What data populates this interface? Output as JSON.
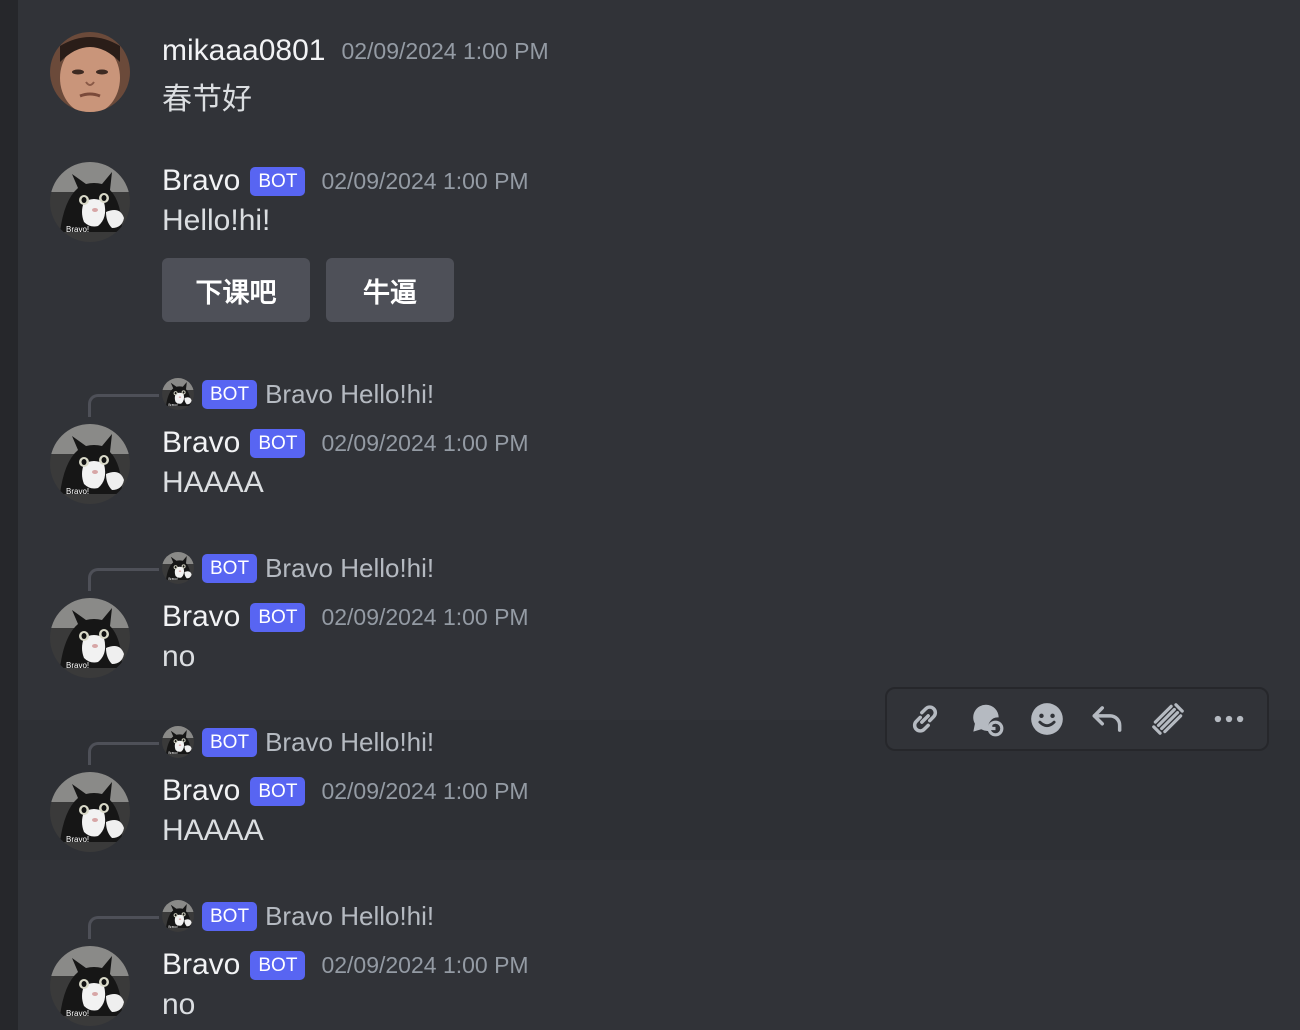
{
  "messages": [
    {
      "username": "mikaaa0801",
      "timestamp": "02/09/2024 1:00 PM",
      "content": "春节好"
    },
    {
      "username": "Bravo",
      "bot_tag": "BOT",
      "timestamp": "02/09/2024 1:00 PM",
      "content": "Hello!hi!",
      "buttons": [
        "下课吧",
        "牛逼"
      ]
    },
    {
      "reply": {
        "tag": "BOT",
        "text": "Bravo Hello!hi!"
      },
      "username": "Bravo",
      "bot_tag": "BOT",
      "timestamp": "02/09/2024 1:00 PM",
      "content": "HAAAA"
    },
    {
      "reply": {
        "tag": "BOT",
        "text": "Bravo Hello!hi!"
      },
      "username": "Bravo",
      "bot_tag": "BOT",
      "timestamp": "02/09/2024 1:00 PM",
      "content": "no"
    },
    {
      "reply": {
        "tag": "BOT",
        "text": "Bravo Hello!hi!"
      },
      "username": "Bravo",
      "bot_tag": "BOT",
      "timestamp": "02/09/2024 1:00 PM",
      "content": "HAAAA"
    },
    {
      "reply": {
        "tag": "BOT",
        "text": "Bravo Hello!hi!"
      },
      "username": "Bravo",
      "bot_tag": "BOT",
      "timestamp": "02/09/2024 1:00 PM",
      "content": "no"
    }
  ],
  "avatar_caption": "Bravo!",
  "toolbar": {
    "icons": [
      "link-icon",
      "thread-icon",
      "emoji-icon",
      "reply-icon",
      "bot-icon",
      "more-icon"
    ]
  },
  "colors": {
    "background": "#313338",
    "bot_tag": "#5865f2",
    "button": "#4e5058"
  }
}
